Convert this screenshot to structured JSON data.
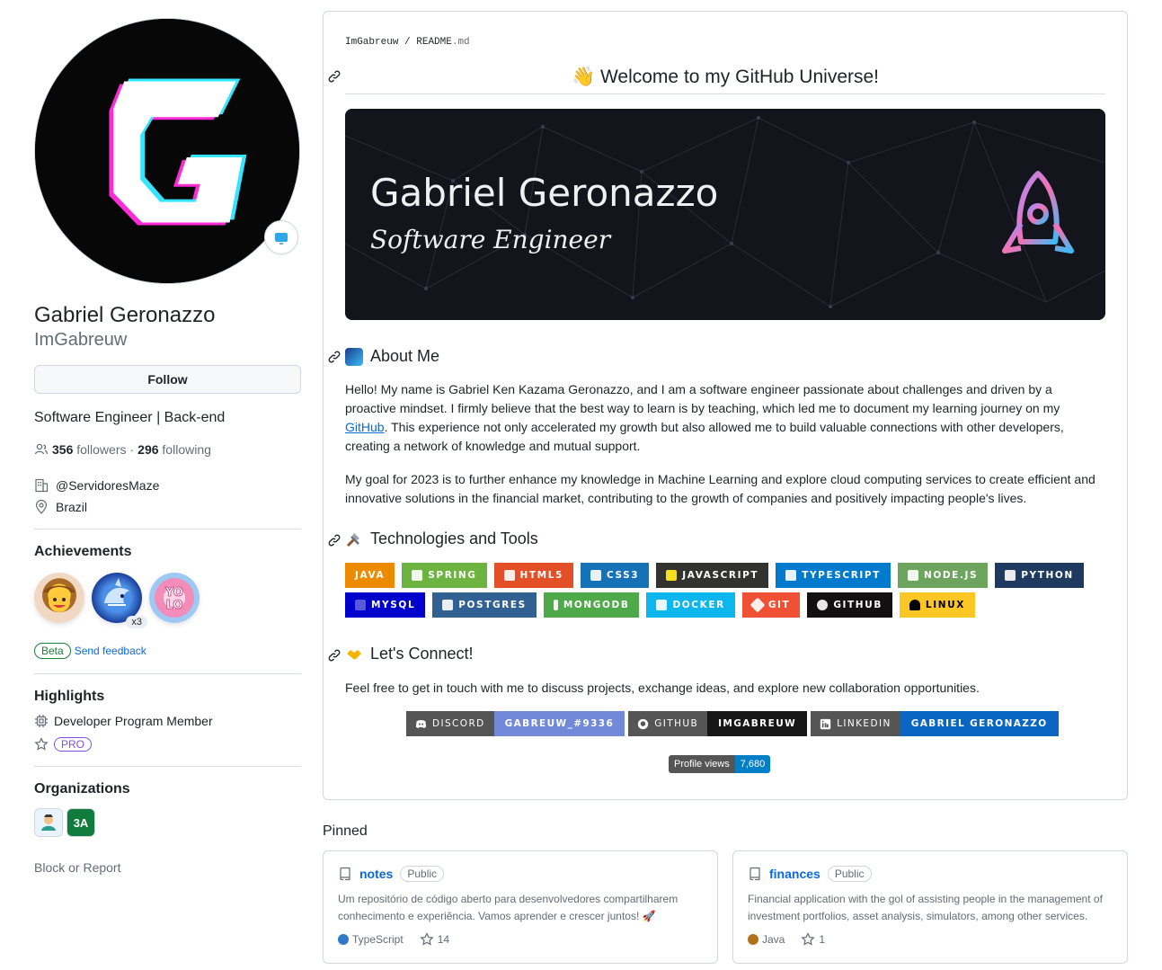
{
  "profile": {
    "full_name": "Gabriel Geronazzo",
    "login": "ImGabreuw",
    "follow_label": "Follow",
    "bio": "Software Engineer | Back-end",
    "followers_count": "356",
    "followers_label": "followers",
    "separator": "·",
    "following_count": "296",
    "following_label": "following",
    "company": "@ServidoresMaze",
    "location": "Brazil"
  },
  "achievements": {
    "title": "Achievements",
    "items": [
      {
        "name": "cowboy-achievement",
        "count": ""
      },
      {
        "name": "shark-achievement",
        "count": "x3"
      },
      {
        "name": "yolo-achievement",
        "count": ""
      }
    ],
    "beta_label": "Beta",
    "feedback_label": "Send feedback"
  },
  "highlights": {
    "title": "Highlights",
    "developer_program": "Developer Program Member",
    "pro_label": "PRO"
  },
  "organizations": {
    "title": "Organizations",
    "items": [
      "3A"
    ]
  },
  "block_report": "Block or Report",
  "readme": {
    "path_user": "ImGabreuw",
    "path_sep": "/",
    "path_file": "README",
    "path_ext": ".md",
    "welcome": "👋 Welcome to my GitHub Universe!",
    "banner_name": "Gabriel Geronazzo",
    "banner_role": "Software Engineer",
    "about_title": "About Me",
    "about_p1_before": "Hello! My name is Gabriel Ken Kazama Geronazzo, and I am a software engineer passionate about challenges and driven by a proactive mindset. I firmly believe that the best way to learn is by teaching, which led me to document my learning journey on my ",
    "about_p1_link": "GitHub",
    "about_p1_after": ". This experience not only accelerated my growth but also allowed me to build valuable connections with other developers, creating a network of knowledge and mutual support.",
    "about_p2": "My goal for 2023 is to further enhance my knowledge in Machine Learning and explore cloud computing services to create efficient and innovative solutions in the financial market, contributing to the growth of companies and positively impacting people's lives.",
    "tech_title": "Technologies and Tools",
    "tech_row1": [
      {
        "label": "JAVA",
        "color": "#ed8b00"
      },
      {
        "label": "SPRING",
        "color": "#6db33f"
      },
      {
        "label": "HTML5",
        "color": "#e34f26"
      },
      {
        "label": "CSS3",
        "color": "#1572b6"
      },
      {
        "label": "JAVASCRIPT",
        "color": "#323330"
      },
      {
        "label": "TYPESCRIPT",
        "color": "#007acc"
      },
      {
        "label": "NODE.JS",
        "color": "#6da55f"
      },
      {
        "label": "PYTHON",
        "color": "#3670a0"
      }
    ],
    "tech_row2": [
      {
        "label": "MYSQL",
        "color": "#00f"
      },
      {
        "label": "POSTGRES",
        "color": "#316192"
      },
      {
        "label": "MONGODB",
        "color": "#4ea94b"
      },
      {
        "label": "DOCKER",
        "color": "#0db7ed"
      },
      {
        "label": "GIT",
        "color": "#f05033"
      },
      {
        "label": "GITHUB",
        "color": "#121011"
      },
      {
        "label": "LINUX",
        "color": "#fcc624"
      }
    ],
    "connect_title": "Let's Connect!",
    "connect_text": "Feel free to get in touch with me to discuss projects, exchange ideas, and explore new collaboration opportunities.",
    "connect": [
      {
        "left": "DISCORD",
        "right": "GABREUW_#9336",
        "left_color": "#555555",
        "right_color": "#7289da"
      },
      {
        "left": "GITHUB",
        "right": "IMGABREUW",
        "left_color": "#555555",
        "right_color": "#181717"
      },
      {
        "left": "LINKEDIN",
        "right": "GABRIEL GERONAZZO",
        "left_color": "#555555",
        "right_color": "#0a66c2"
      }
    ],
    "views_label": "Profile views",
    "views_value": "7,680"
  },
  "pinned": {
    "title": "Pinned",
    "repos": [
      {
        "name": "notes",
        "visibility": "Public",
        "description": "Um repositório de código aberto para desenvolvedores compartilharem conhecimento e experiência. Vamos aprender e crescer juntos! 🚀",
        "language": "TypeScript",
        "language_color": "#3178c6",
        "stars": "14"
      },
      {
        "name": "finances",
        "visibility": "Public",
        "description": "Financial application with the gol of assisting people in the management of investment portfolios, asset analysis, simulators, among other services.",
        "language": "Java",
        "language_color": "#b07219",
        "stars": "1"
      }
    ]
  }
}
